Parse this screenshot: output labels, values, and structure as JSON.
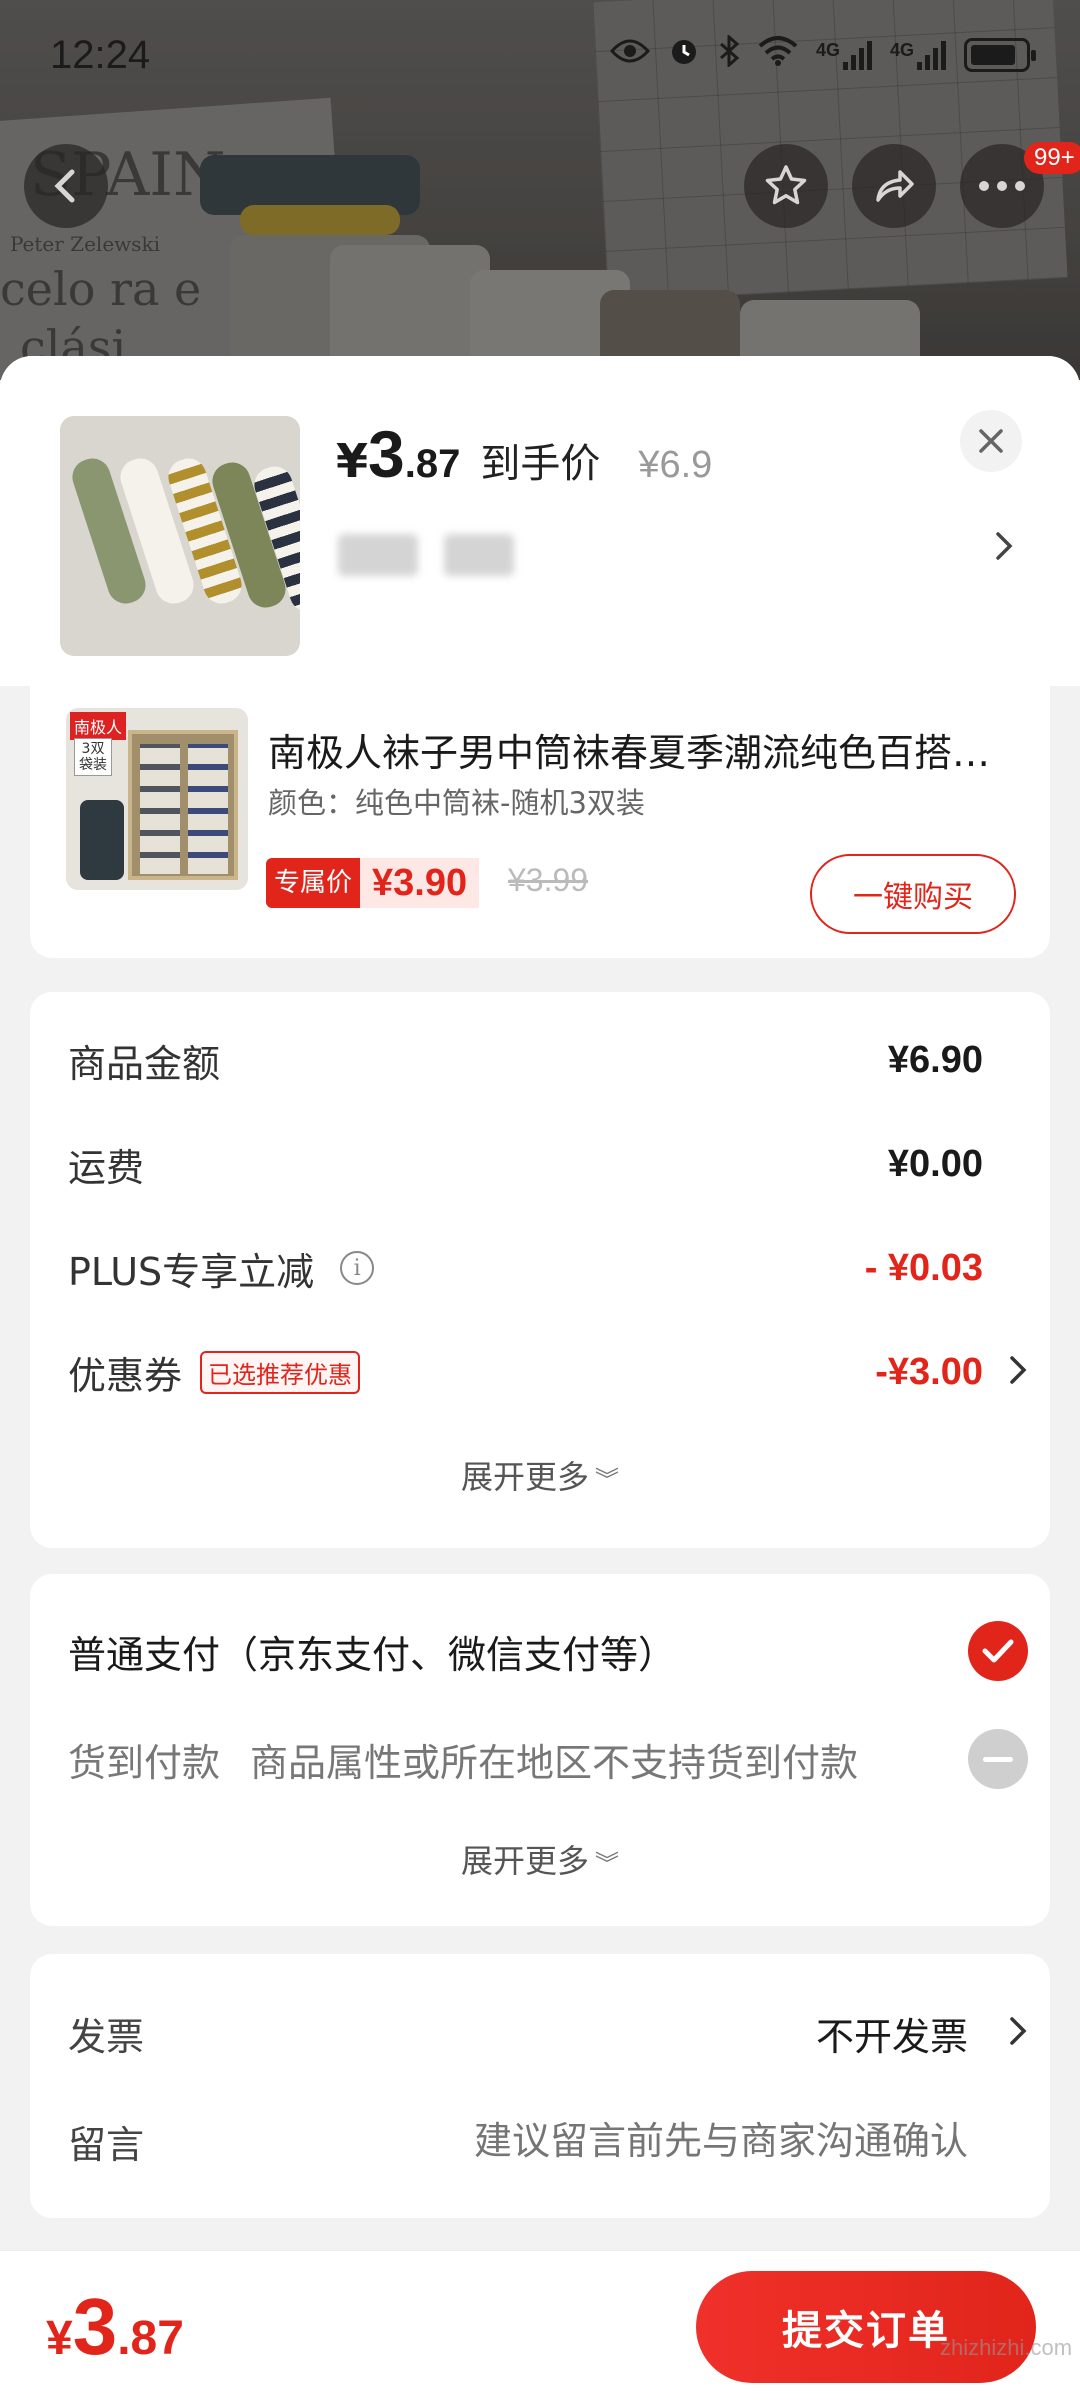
{
  "status_bar": {
    "time": "12:24",
    "icons": [
      "eye-icon",
      "alarm-icon",
      "bluetooth-icon",
      "wifi-icon",
      "signal-4g-icon",
      "signal-4g-icon",
      "battery-icon"
    ],
    "network_1": "4G",
    "network_2": "4G"
  },
  "background": {
    "text_1": "SPAIN",
    "text_2": "Peter Zelewski",
    "text_3": "celo ra e",
    "text_4": "clási"
  },
  "top_actions": {
    "badge": "99+"
  },
  "summary": {
    "price_symbol": "¥",
    "price_int": "3",
    "price_dec": ".87",
    "price_label": "到手价",
    "original_price": "¥6.9"
  },
  "product": {
    "brand_tag": "南极人",
    "pack_tag": "3双\n袋装",
    "title": "南极人袜子男中筒袜春夏季潮流纯色百搭…",
    "spec": "颜色：纯色中筒袜-随机3双装",
    "exclusive_tag": "专属价",
    "exclusive_price": "¥3.90",
    "strike_price": "¥3.99",
    "buy_button": "一键购买"
  },
  "fees": {
    "goods_label": "商品金额",
    "goods_value": "¥6.90",
    "shipping_label": "运费",
    "shipping_value": "¥0.00",
    "plus_label": "PLUS专享立减",
    "plus_value": "- ¥0.03",
    "coupon_label": "优惠券",
    "coupon_tag": "已选推荐优惠",
    "coupon_value": "-¥3.00",
    "expand": "展开更多"
  },
  "payment": {
    "normal_label": "普通支付（京东支付、微信支付等）",
    "cod_label": "货到付款",
    "cod_desc": "商品属性或所在地区不支持货到付款",
    "expand": "展开更多"
  },
  "invoice": {
    "invoice_label": "发票",
    "invoice_value": "不开发票",
    "message_label": "留言",
    "message_placeholder": "建议留言前先与商家沟通确认"
  },
  "bottom": {
    "total_symbol": "¥",
    "total_int": "3",
    "total_dec": ".87",
    "submit": "提交订单",
    "watermark": "zhizhizhi.com"
  },
  "colors": {
    "accent": "#e1251b",
    "background": "#f2f2f2"
  }
}
